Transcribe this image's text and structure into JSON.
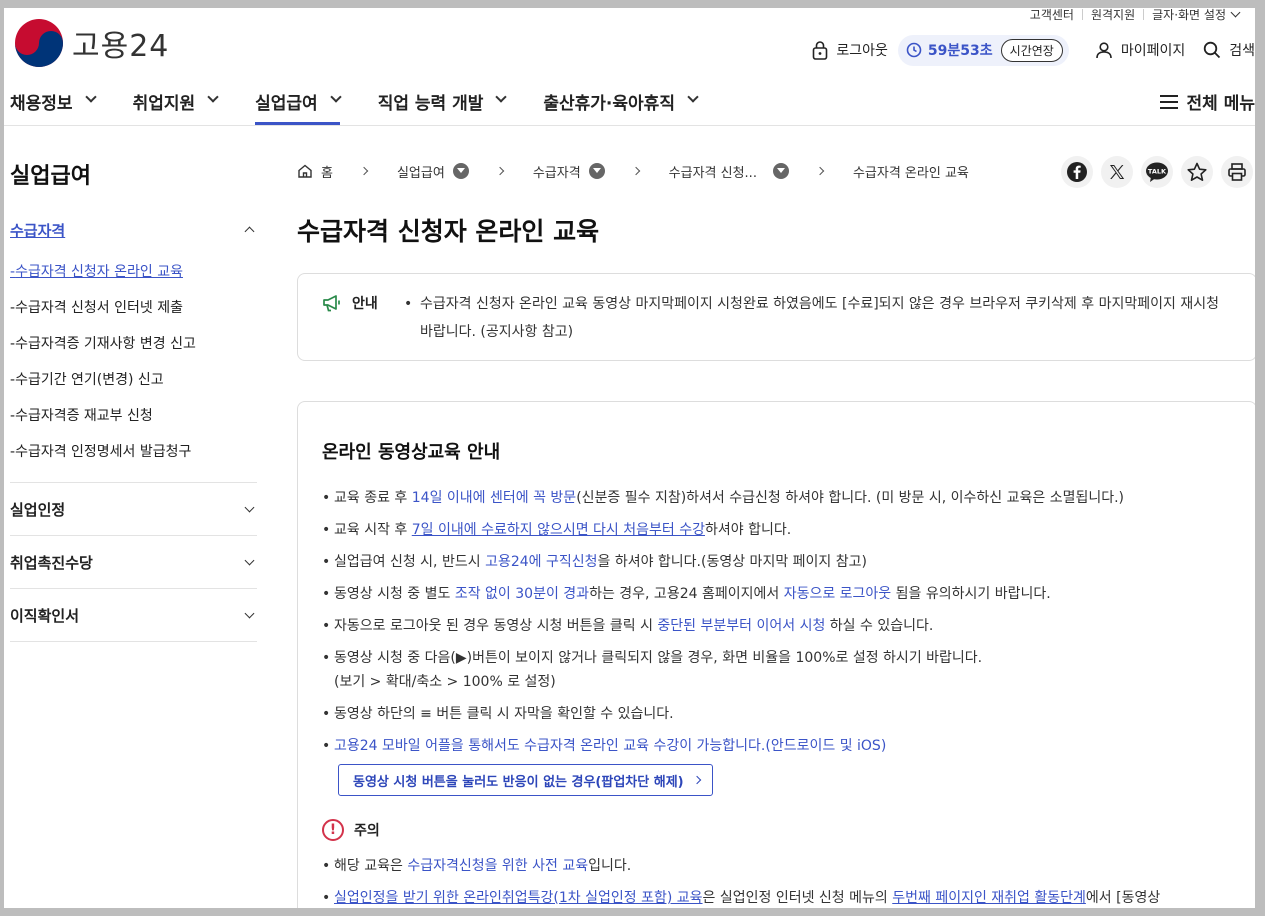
{
  "utility": {
    "customer_center": "고객센터",
    "remote_support": "원격지원",
    "display_settings": "글자·화면 설정"
  },
  "brand": {
    "name": "고용24"
  },
  "header": {
    "logout": "로그아웃",
    "timer": "59분53초",
    "extend": "시간연장",
    "mypage": "마이페이지",
    "search": "검색"
  },
  "gnb": {
    "items": [
      "채용정보",
      "취업지원",
      "실업급여",
      "직업 능력 개발",
      "출산휴가·육아휴직"
    ],
    "active_index": 2,
    "all_menu": "전체 메뉴"
  },
  "sidebar": {
    "title": "실업급여",
    "groups": [
      {
        "label": "수급자격",
        "open": true,
        "items": [
          "수급자격 신청자 온라인 교육",
          "수급자격 신청서 인터넷 제출",
          "수급자격증 기재사항 변경 신고",
          "수급기간 연기(변경) 신고",
          "수급자격증 재교부 신청",
          "수급자격 인정명세서 발급청구"
        ]
      },
      {
        "label": "실업인정",
        "open": false
      },
      {
        "label": "취업촉진수당",
        "open": false
      },
      {
        "label": "이직확인서",
        "open": false
      }
    ]
  },
  "breadcrumb": {
    "home": "홈",
    "items": [
      "실업급여",
      "수급자격",
      "수급자격 신청..."
    ],
    "current": "수급자격 온라인 교육"
  },
  "share": {
    "icons": [
      "facebook-icon",
      "x-icon",
      "kakaotalk-icon",
      "favorite-star-icon",
      "print-icon"
    ],
    "talk_text": "TALK"
  },
  "page_title": "수급자격 신청자 온라인 교육",
  "notice": {
    "label": "안내",
    "text": "수급자격 신청자 온라인 교육 동영상 마지막페이지 시청완료 하였음에도 [수료]되지 않은 경우 브라우저 쿠키삭제 후 마지막페이지 재시청 바랍니다. (공지사항 참고)"
  },
  "content": {
    "title": "온라인 동영상교육 안내",
    "b1": {
      "pre": "교육 종료 후 ",
      "hl": "14일 이내에 센터에 꼭 방문",
      "post": "(신분증 필수 지참)하셔서 수급신청 하셔야 합니다. (미 방문 시, 이수하신 교육은 소멸됩니다.)"
    },
    "b2": {
      "pre": "교육 시작 후 ",
      "ul": "7일 이내에 수료하지 않으시면 다시 처음부터 수강",
      "post": "하셔야 합니다."
    },
    "b3": {
      "pre": "실업급여 신청 시, 반드시 ",
      "hl": "고용24에 구직신청",
      "post": "을 하셔야 합니다.(동영상 마지막 페이지 참고)"
    },
    "b4": {
      "pre": "동영상 시청 중 별도 ",
      "hl1": "조작 없이 30분이 경과",
      "mid": "하는 경우, 고용24 홈페이지에서 ",
      "hl2": "자동으로 로그아웃",
      "post": " 됨을 유의하시기 바랍니다."
    },
    "b5": {
      "pre": "자동으로 로그아웃 된 경우 동영상 시청 버튼을 클릭 시 ",
      "hl": "중단된 부분부터 이어서 시청",
      "post": " 하실 수 있습니다."
    },
    "b6": {
      "line1": "동영상 시청 중 다음(▶)버튼이 보이지 않거나 클릭되지 않을 경우, 화면 비율을 100%로 설정 하시기 바랍니다.",
      "line2": "(보기 > 확대/축소 > 100% 로 설정)"
    },
    "b7": "동영상 하단의 ≡ 버튼 클릭 시 자막을 확인할 수 있습니다.",
    "b8": "고용24 모바일 어플을 통해서도 수급자격 온라인 교육 수강이 가능합니다.(안드로이드 및 iOS)",
    "popup_button": "동영상 시청 버튼을 눌러도 반응이 없는 경우(팝업차단 해제)",
    "caution_label": "주의",
    "c1": {
      "pre": "해당 교육은 ",
      "hl": "수급자격신청을 위한 사전 교육",
      "post": "입니다."
    },
    "c2": {
      "ul1": "실업인정을 받기 위한 온라인취업특강(1차 실업인정 포함) 교육",
      "mid": "은 실업인정 인터넷 신청 메뉴의 ",
      "ul2": "두번째 페이지인 재취업 활동단계",
      "post": "에서 [동영상"
    }
  },
  "colors": {
    "accent": "#3b54c7",
    "caution": "#d3324a"
  }
}
